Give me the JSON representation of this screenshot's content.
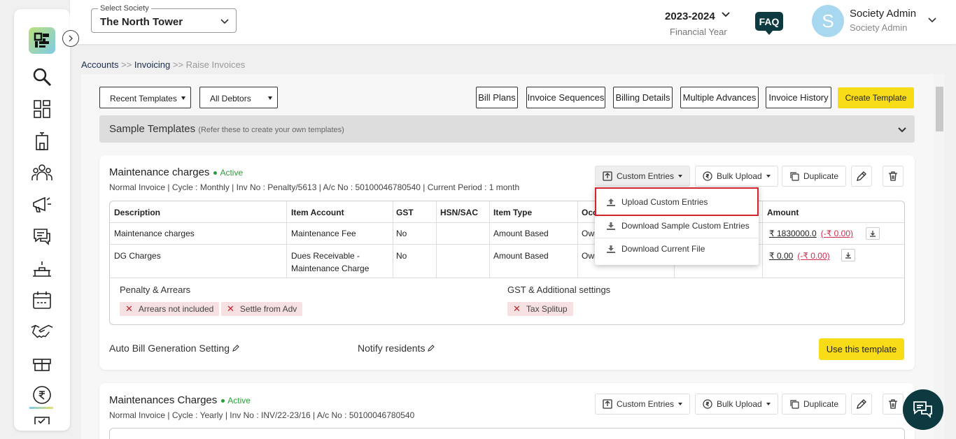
{
  "header": {
    "society_label": "Select Society",
    "society_value": "The North Tower",
    "fy_year": "2023-2024",
    "fy_label": "Financial Year",
    "faq": "FAQ",
    "avatar_letter": "S",
    "user_name": "Society Admin",
    "user_role": "Society Admin"
  },
  "sidebar": {
    "icons": [
      "search-icon",
      "dashboard-icon",
      "building-icon",
      "residents-icon",
      "announcement-icon",
      "chat-icon",
      "amenity-icon",
      "calendar-icon",
      "handshake-icon",
      "gift-icon",
      "rupee-icon",
      "report-icon"
    ]
  },
  "breadcrumb": {
    "accounts": "Accounts",
    "sep1": ">>",
    "invoicing": "Invoicing",
    "sep2": ">>",
    "current": "Raise Invoices"
  },
  "toolbar": {
    "recent_templates": "Recent Templates",
    "all_debtors": "All Debtors",
    "bill_plans": "Bill Plans",
    "invoice_sequences": "Invoice Sequences",
    "billing_details": "Billing Details",
    "multiple_advances": "Multiple Advances",
    "invoice_history": "Invoice History",
    "create_template": "Create Template"
  },
  "samples": {
    "title": "Sample Templates",
    "hint": "(Refer these to create your own templates)"
  },
  "actions": {
    "custom_entries": "Custom Entries",
    "bulk_upload": "Bulk Upload",
    "duplicate": "Duplicate"
  },
  "dropdown": {
    "upload": "Upload Custom Entries",
    "download_sample": "Download Sample Custom Entries",
    "download_current": "Download Current File"
  },
  "card1": {
    "title": "Maintenance charges",
    "status": "Active",
    "meta": "Normal Invoice | Cycle : Monthly | Inv No : Penalty/5613 | A/c No : 50100046780540 | Current Period : 1 month",
    "columns": {
      "description": "Description",
      "item_account": "Item Account",
      "gst": "GST",
      "hsn": "HSN/SAC",
      "item_type": "Item Type",
      "occ": "Occ",
      "amount": "Amount"
    },
    "rows": [
      {
        "description": "Maintenance charges",
        "item_account_1": "Maintenance Fee",
        "item_account_2": "",
        "gst": "No",
        "item_type": "Amount Based",
        "occ": "Own",
        "amount": "₹ 1830000.0",
        "amount_neg": "(-₹ 0.00)"
      },
      {
        "description": "DG Charges",
        "item_account_1": "Dues Receivable -",
        "item_account_2": "Maintenance Charge",
        "gst": "No",
        "item_type": "Amount Based",
        "occ": "Own",
        "amount": "₹ 0.00",
        "amount_neg": "(-₹ 0.00)"
      }
    ],
    "penalty_label": "Penalty & Arrears",
    "penalty_chips": [
      "Arrears not included",
      "Settle from Adv"
    ],
    "gst_label": "GST & Additional settings",
    "gst_chips": [
      "Tax Splitup"
    ],
    "auto_bill": "Auto Bill Generation Setting",
    "notify": "Notify residents",
    "use_template": "Use this template"
  },
  "card2": {
    "title": "Maintenances Charges",
    "status": "Active",
    "meta": "Normal Invoice | Cycle : Yearly | Inv No : INV/22-23/16 | A/c No : 50100046780540"
  }
}
